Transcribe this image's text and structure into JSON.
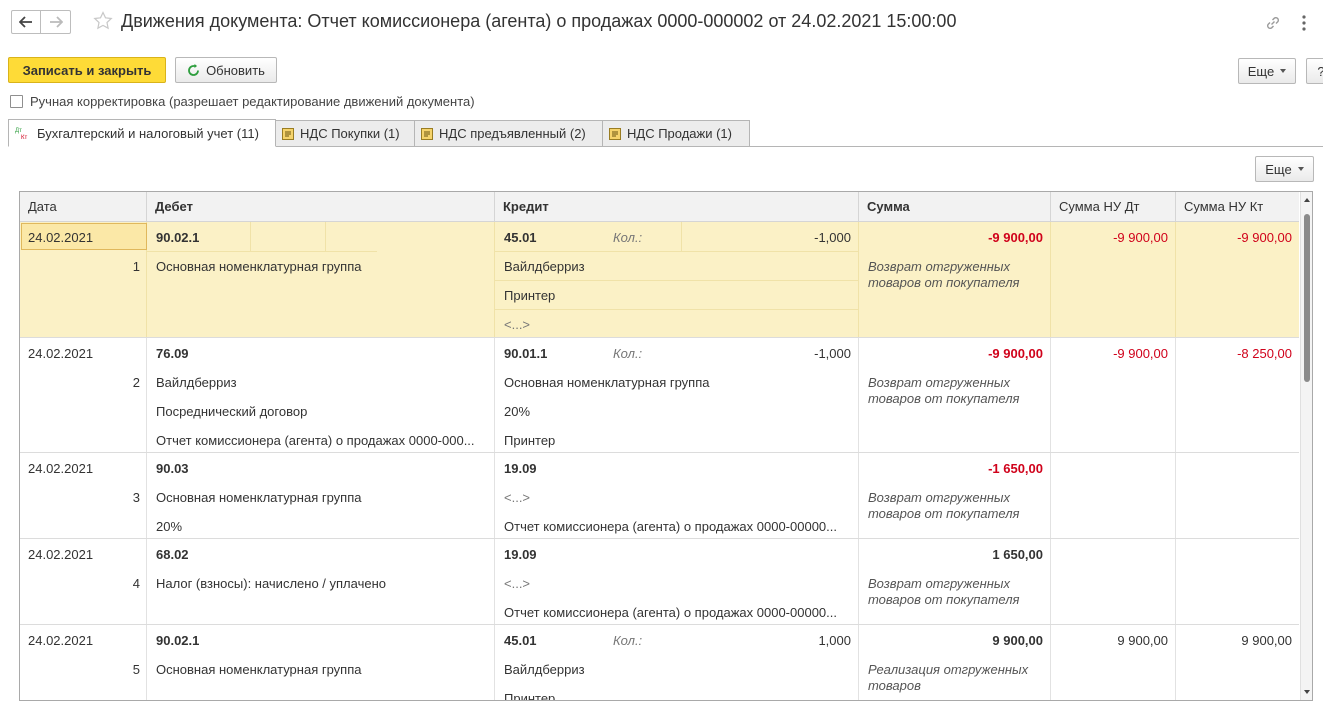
{
  "window": {
    "title": "Движения документа: Отчет комиссионера (агента) о продажах 0000-000002 от 24.02.2021 15:00:00"
  },
  "toolbar": {
    "save_close": "Записать и закрыть",
    "refresh": "Обновить",
    "more": "Еще",
    "help": "?"
  },
  "manual_correction": {
    "label": "Ручная корректировка (разрешает редактирование движений документа)",
    "checked": false
  },
  "tabs": [
    {
      "label": "Бухгалтерский и налоговый учет (11)",
      "icon": "dt-kt-icon",
      "active": true
    },
    {
      "label": "НДС Покупки (1)",
      "icon": "register-icon",
      "active": false
    },
    {
      "label": "НДС предъявленный (2)",
      "icon": "register-icon",
      "active": false
    },
    {
      "label": "НДС Продажи (1)",
      "icon": "register-icon",
      "active": false
    }
  ],
  "table_more": "Еще",
  "columns": {
    "date": "Дата",
    "debit": "Дебет",
    "credit": "Кредит",
    "sum": "Сумма",
    "sum_nu_dt": "Сумма НУ Дт",
    "sum_nu_kt": "Сумма НУ Кт"
  },
  "rows": [
    {
      "date": "24.02.2021",
      "num": "1",
      "debit": {
        "account": "90.02.1",
        "sub": [
          "Основная номенклатурная группа",
          "",
          ""
        ]
      },
      "credit": {
        "account": "45.01",
        "qty_label": "Кол.:",
        "qty": "-1,000",
        "sub": [
          "Вайлдберриз",
          "Принтер",
          "<...>"
        ]
      },
      "sum": "-9 900,00",
      "sum_red": true,
      "content": "Возврат отгруженных товаров от покупателя",
      "nu_dt": "-9 900,00",
      "nu_kt": "-9 900,00",
      "nu_red": true
    },
    {
      "date": "24.02.2021",
      "num": "2",
      "debit": {
        "account": "76.09",
        "sub": [
          "Вайлдберриз",
          "Посреднический договор",
          "Отчет комиссионера (агента) о продажах 0000-000..."
        ]
      },
      "credit": {
        "account": "90.01.1",
        "qty_label": "Кол.:",
        "qty": "-1,000",
        "sub": [
          "Основная номенклатурная группа",
          "20%",
          "Принтер"
        ]
      },
      "sum": "-9 900,00",
      "sum_red": true,
      "content": "Возврат отгруженных товаров от покупателя",
      "nu_dt": "-9 900,00",
      "nu_kt": "-8 250,00",
      "nu_red": true
    },
    {
      "date": "24.02.2021",
      "num": "3",
      "debit": {
        "account": "90.03",
        "sub": [
          "Основная номенклатурная группа",
          "20%"
        ]
      },
      "credit": {
        "account": "19.09",
        "qty_label": "",
        "qty": "",
        "sub": [
          "<...>",
          "Отчет комиссионера (агента) о продажах 0000-00000..."
        ]
      },
      "sum": "-1 650,00",
      "sum_red": true,
      "content": "Возврат отгруженных товаров от покупателя",
      "nu_dt": "",
      "nu_kt": "",
      "nu_red": false
    },
    {
      "date": "24.02.2021",
      "num": "4",
      "debit": {
        "account": "68.02",
        "sub": [
          "Налог (взносы): начислено / уплачено"
        ]
      },
      "credit": {
        "account": "19.09",
        "qty_label": "",
        "qty": "",
        "sub": [
          "<...>",
          "Отчет комиссионера (агента) о продажах 0000-00000..."
        ]
      },
      "sum": "1 650,00",
      "sum_red": false,
      "content": "Возврат отгруженных товаров от покупателя",
      "nu_dt": "",
      "nu_kt": "",
      "nu_red": false
    },
    {
      "date": "24.02.2021",
      "num": "5",
      "debit": {
        "account": "90.02.1",
        "sub": [
          "Основная номенклатурная группа"
        ]
      },
      "credit": {
        "account": "45.01",
        "qty_label": "Кол.:",
        "qty": "1,000",
        "sub": [
          "Вайлдберриз",
          "Принтер"
        ]
      },
      "sum": "9 900,00",
      "sum_red": false,
      "content": "Реализация отгруженных товаров",
      "nu_dt": "9 900,00",
      "nu_kt": "9 900,00",
      "nu_red": false
    }
  ]
}
